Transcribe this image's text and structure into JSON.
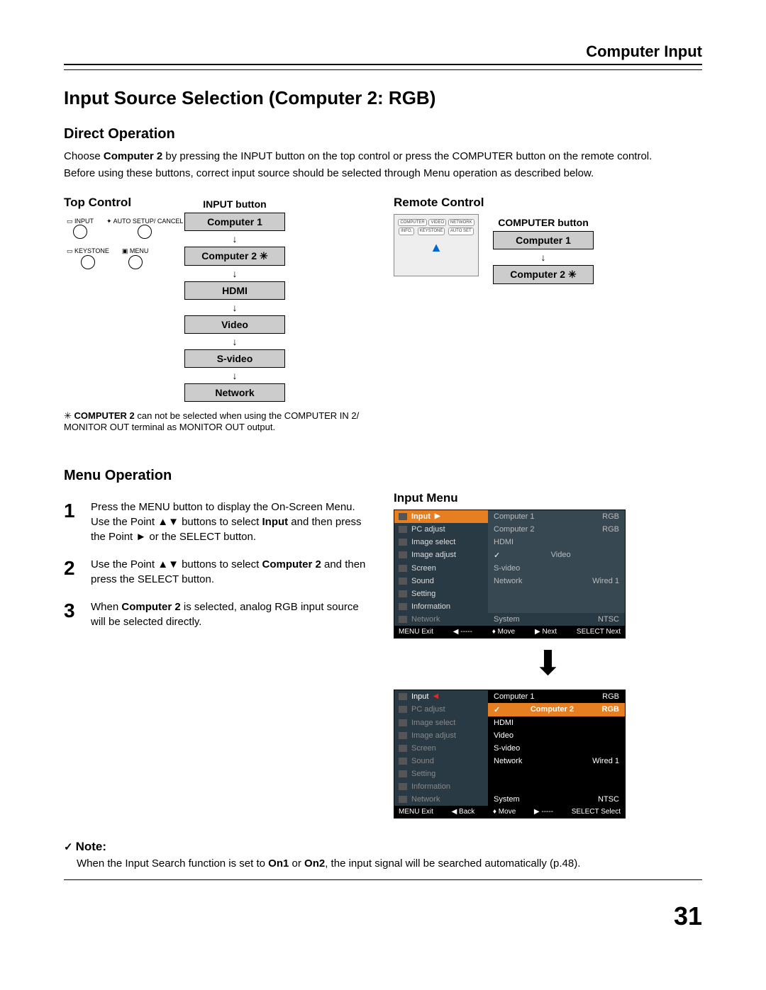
{
  "header": {
    "title": "Computer Input"
  },
  "section_title": "Input Source Selection (Computer 2: RGB)",
  "direct_operation": {
    "heading": "Direct Operation",
    "para1_a": "Choose ",
    "para1_bold": "Computer 2",
    "para1_b": " by pressing the INPUT button on the top control or press the COMPUTER button on the remote control.",
    "para2": "Before using these buttons, correct input source should be selected through Menu operation as described below."
  },
  "top_control": {
    "label": "Top Control",
    "input_button": "INPUT button",
    "items": [
      "Computer 1",
      "Computer 2 ✳",
      "HDMI",
      "Video",
      "S-video",
      "Network"
    ],
    "labels": {
      "input": "INPUT",
      "auto": "AUTO SETUP/\nCANCEL",
      "keystone": "KEYSTONE",
      "menu": "MENU"
    }
  },
  "remote_control": {
    "label": "Remote Control",
    "button_label": "COMPUTER button",
    "items": [
      "Computer 1",
      "Computer 2 ✳"
    ],
    "btns": {
      "computer": "COMPUTER",
      "video": "VIDEO",
      "network": "NETWORK",
      "info": "INFO.",
      "keystone": "KEYSTONE",
      "autoset": "AUTO SET"
    }
  },
  "footnote": {
    "star": "✳",
    "bold": "COMPUTER 2",
    "text": " can not be selected when using the COMPUTER IN 2/ MONITOR OUT terminal as MONITOR OUT output."
  },
  "menu_operation": {
    "heading": "Menu Operation",
    "steps": [
      {
        "num": "1",
        "a": "Press the MENU button to display the On-Screen Menu. Use the Point ▲▼ buttons to select ",
        "bold": "Input",
        "b": " and then press the Point ► or the SELECT button."
      },
      {
        "num": "2",
        "a": "Use the Point ▲▼ buttons to select ",
        "bold": "Computer 2",
        "b": " and then press the SELECT button."
      },
      {
        "num": "3",
        "a": "When ",
        "bold": "Computer 2",
        "b": " is selected, analog RGB input source will be selected directly."
      }
    ]
  },
  "input_menu_label": "Input Menu",
  "osd_menu_items": [
    "Input",
    "PC adjust",
    "Image select",
    "Image adjust",
    "Screen",
    "Sound",
    "Setting",
    "Information",
    "Network"
  ],
  "osd1": {
    "subs": [
      {
        "name": "Computer 1",
        "val": "RGB"
      },
      {
        "name": "Computer 2",
        "val": "RGB"
      },
      {
        "name": "HDMI",
        "val": ""
      },
      {
        "name": "Video",
        "val": "",
        "check": true
      },
      {
        "name": "S-video",
        "val": ""
      },
      {
        "name": "Network",
        "val": "Wired 1"
      }
    ],
    "system_row": {
      "name": "System",
      "val": "NTSC"
    },
    "footer": {
      "exit": "MENU Exit",
      "back": "◀ -----",
      "move": "♦ Move",
      "next": "▶ Next",
      "select": "SELECT Next"
    }
  },
  "osd2": {
    "subs": [
      {
        "name": "Computer 1",
        "val": "RGB"
      },
      {
        "name": "Computer 2",
        "val": "RGB",
        "sel": true,
        "check": true
      },
      {
        "name": "HDMI",
        "val": ""
      },
      {
        "name": "Video",
        "val": ""
      },
      {
        "name": "S-video",
        "val": ""
      },
      {
        "name": "Network",
        "val": "Wired 1"
      }
    ],
    "system_row": {
      "name": "System",
      "val": "NTSC"
    },
    "footer": {
      "exit": "MENU Exit",
      "back": "◀ Back",
      "move": "♦ Move",
      "next": "▶ -----",
      "select": "SELECT Select"
    }
  },
  "note": {
    "heading": "Note:",
    "a": "When the Input Search function is set to ",
    "b1": "On1",
    "or": " or ",
    "b2": "On2",
    "c": ", the input signal will be searched automatically (p.48)."
  },
  "page_number": "31"
}
